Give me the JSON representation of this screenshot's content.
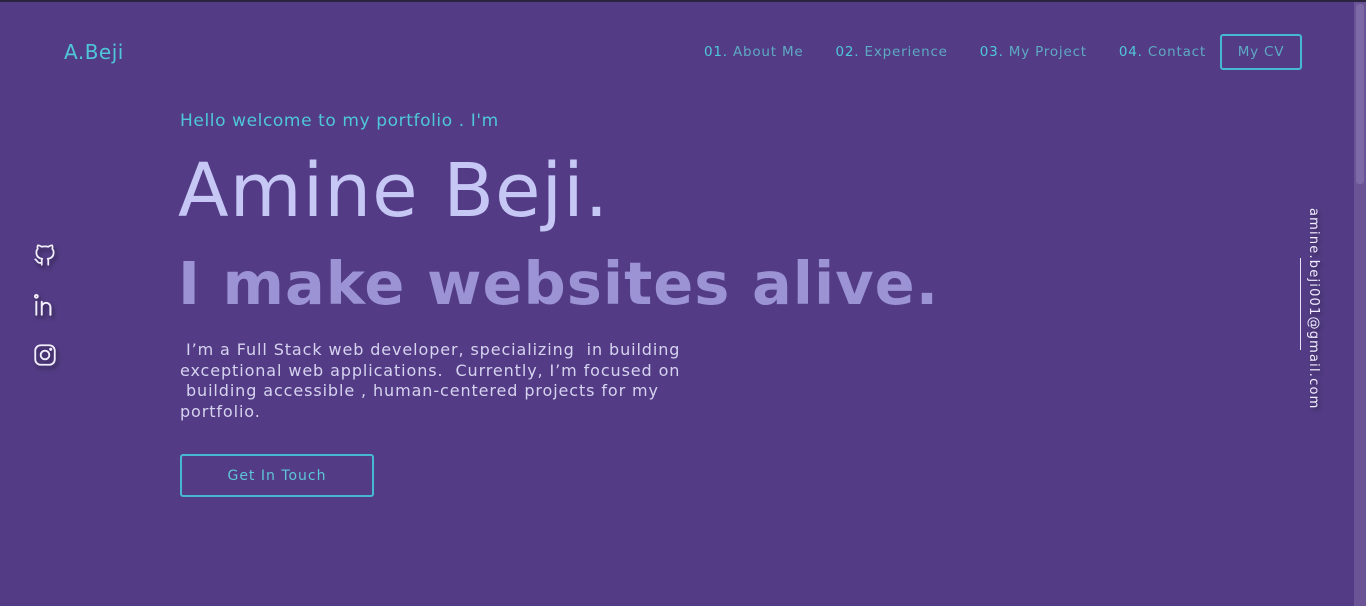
{
  "brand": {
    "logo": "A.Beji"
  },
  "nav": {
    "items": [
      {
        "num": "01.",
        "label": "About Me"
      },
      {
        "num": "02.",
        "label": "Experience"
      },
      {
        "num": "03.",
        "label": "My Project"
      },
      {
        "num": "04.",
        "label": "Contact"
      }
    ],
    "cv_label": "My CV"
  },
  "hero": {
    "greeting": "Hello welcome to my portfolio . I'm",
    "name": "Amine Beji.",
    "tagline": "I make websites alive.",
    "bio_lines": [
      " I’m a Full Stack web developer, specializing  in building",
      "exceptional web applications.  Currently, I’m focused on",
      " building accessible , human-centered projects for my",
      "portfolio."
    ],
    "cta_label": "Get In Touch"
  },
  "social": {
    "icons": [
      "github-icon",
      "linkedin-icon",
      "instagram-icon"
    ]
  },
  "contact": {
    "email": "amine.beji001@gmail.com"
  },
  "colors": {
    "background": "#533c85",
    "accent": "#4fc7d8",
    "name": "#c6c7f5",
    "tagline": "#9b93d4"
  }
}
